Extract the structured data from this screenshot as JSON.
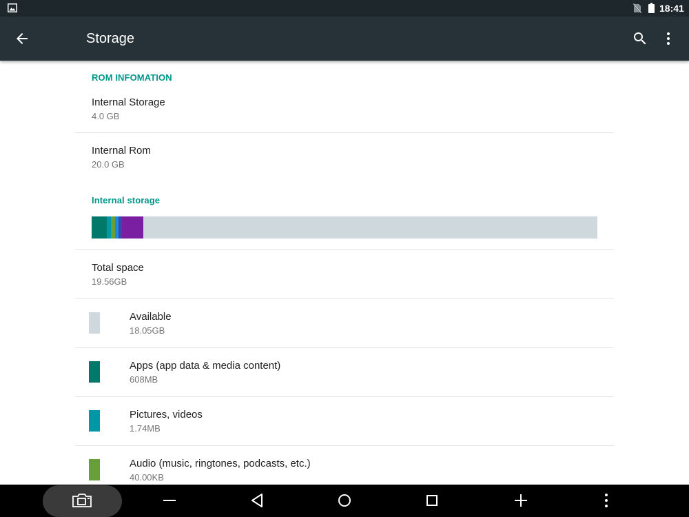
{
  "status_bar": {
    "time": "18:41",
    "icons": [
      "image-notification-icon",
      "no-sim-icon",
      "battery-icon"
    ]
  },
  "app_bar": {
    "title": "Storage",
    "icons": [
      "back-arrow-icon",
      "search-icon",
      "more-vert-icon"
    ]
  },
  "rom_section": {
    "header": "ROM INFOMATION",
    "items": [
      {
        "title": "Internal Storage",
        "summary": "4.0 GB"
      },
      {
        "title": "Internal Rom",
        "summary": "20.0 GB"
      }
    ]
  },
  "internal_storage": {
    "header": "Internal storage",
    "usage_bar": [
      {
        "category": "Apps (app data & media content)",
        "fraction": 0.03,
        "color": "#00796b"
      },
      {
        "category": "Pictures, videos",
        "fraction": 0.008,
        "color": "#0097a7"
      },
      {
        "category": "Audio (music, ringtones, podcasts, etc.)",
        "fraction": 0.008,
        "color": "#689f38"
      },
      {
        "category": "other-blue",
        "fraction": 0.007,
        "color": "#1e88e5"
      },
      {
        "category": "other-indigo",
        "fraction": 0.007,
        "color": "#3949ab"
      },
      {
        "category": "other-purple",
        "fraction": 0.042,
        "color": "#7b1fa2"
      }
    ],
    "usage_bar_background": "#cfd8dc",
    "total": {
      "title": "Total space",
      "summary": "19.56GB"
    },
    "items": [
      {
        "title": "Available",
        "summary": "18.05GB",
        "color": "#cfd8dc"
      },
      {
        "title": "Apps (app data & media content)",
        "summary": "608MB",
        "color": "#00796b"
      },
      {
        "title": "Pictures, videos",
        "summary": "1.74MB",
        "color": "#0097a7"
      },
      {
        "title": "Audio (music, ringtones, podcasts, etc.)",
        "summary": "40.00KB",
        "color": "#689f38"
      }
    ]
  },
  "nav_bar": {
    "buttons": [
      "screenshot-icon",
      "volume-down-icon",
      "back-triangle-icon",
      "home-circle-icon",
      "recents-square-icon",
      "volume-up-icon",
      "menu-more-icon"
    ]
  },
  "colors": {
    "accent": "#009688",
    "app_bar": "#263238",
    "status_bar": "#1e272b"
  }
}
